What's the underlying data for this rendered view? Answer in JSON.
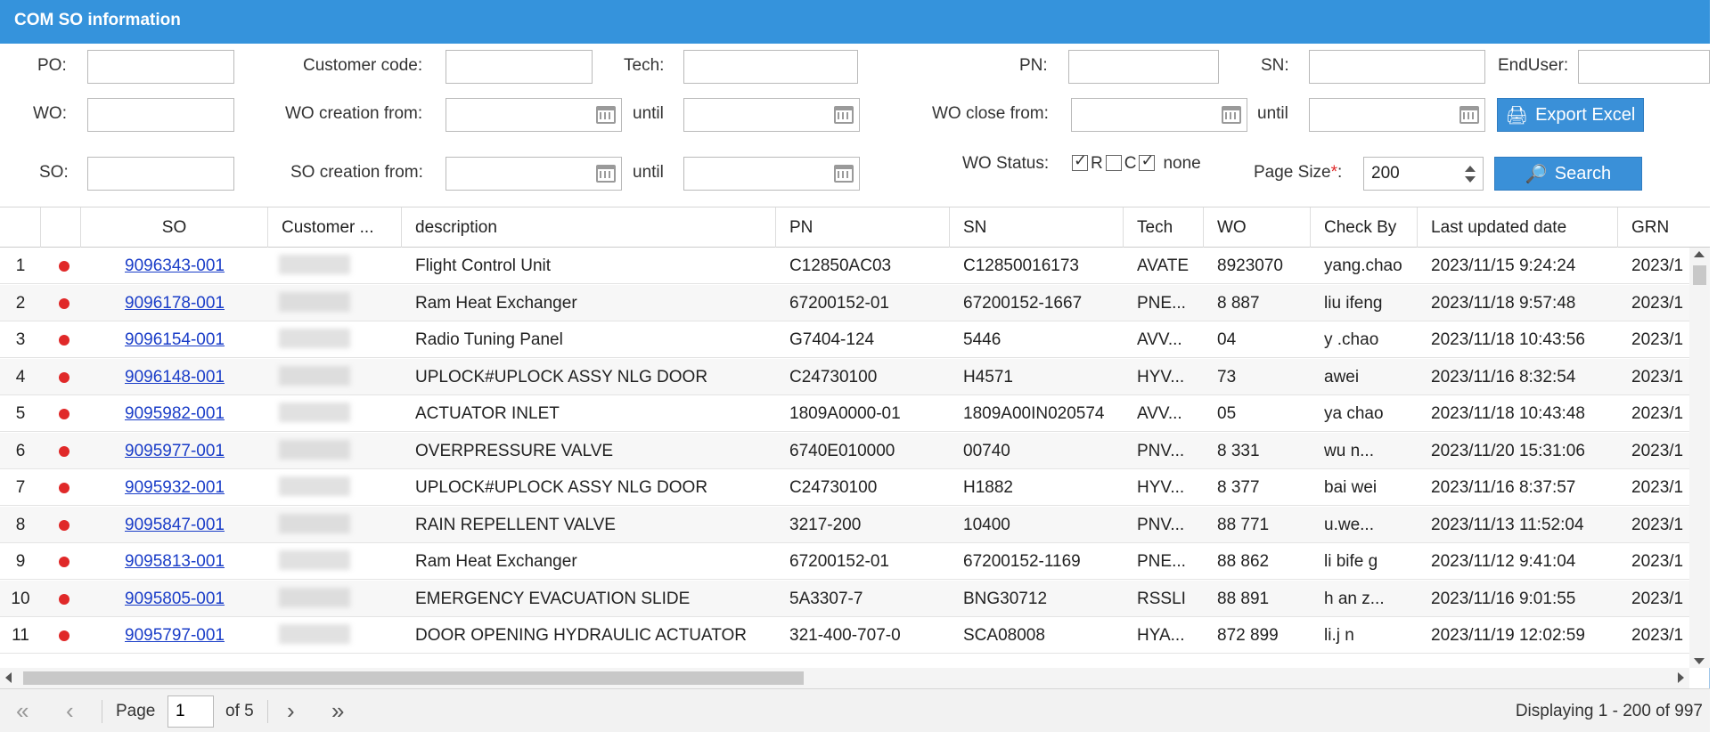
{
  "title": "COM SO information",
  "filters": {
    "po_label": "PO:",
    "customer_code_label": "Customer code:",
    "tech_label": "Tech:",
    "pn_label": "PN:",
    "sn_label": "SN:",
    "enduser_label": "EndUser:",
    "wo_label": "WO:",
    "wo_creation_from_label": "WO creation from:",
    "until_label": "until",
    "wo_close_from_label": "WO close from:",
    "so_label": "SO:",
    "so_creation_from_label": "SO creation from:",
    "wo_status_label": "WO Status:",
    "status_r": "R",
    "status_c": "C",
    "status_none": "none",
    "page_size_label": "Page Size",
    "required_mark": "*",
    "page_size_colon": ":",
    "page_size_value": "200",
    "export_label": "Export Excel",
    "search_label": "Search"
  },
  "columns": [
    "SO",
    "Customer ...",
    "description",
    "PN",
    "SN",
    "Tech",
    "WO",
    "Check By",
    "Last updated date",
    "GRN"
  ],
  "rows": [
    {
      "n": "1",
      "so": "9096343-001",
      "desc": "Flight Control Unit",
      "pn": "C12850AC03",
      "sn": "C12850016173",
      "tech": "AVATE",
      "wo": "8923070",
      "check": "yang.chao",
      "date": "2023/11/15 9:24:24",
      "grn": "2023/1"
    },
    {
      "n": "2",
      "so": "9096178-001",
      "desc": "Ram Heat Exchanger",
      "pn": "67200152-01",
      "sn": "67200152-1667",
      "tech": "PNE...",
      "wo": "8  887",
      "check": "liu  ifeng",
      "date": "2023/11/18 9:57:48",
      "grn": "2023/1"
    },
    {
      "n": "3",
      "so": "9096154-001",
      "desc": "Radio Tuning Panel",
      "pn": "G7404-124",
      "sn": "5446",
      "tech": "AVV...",
      "wo": "  04",
      "check": "y  .chao",
      "date": "2023/11/18 10:43:56",
      "grn": "2023/1"
    },
    {
      "n": "4",
      "so": "9096148-001",
      "desc": "UPLOCK#UPLOCK ASSY NLG DOOR",
      "pn": "C24730100",
      "sn": "H4571",
      "tech": "HYV...",
      "wo": "  73",
      "check": "  awei",
      "date": "2023/11/16 8:32:54",
      "grn": "2023/1"
    },
    {
      "n": "5",
      "so": "9095982-001",
      "desc": "ACTUATOR INLET",
      "pn": "1809A0000-01",
      "sn": "1809A00IN020574",
      "tech": "AVV...",
      "wo": "  05",
      "check": "ya  chao",
      "date": "2023/11/18 10:43:48",
      "grn": "2023/1"
    },
    {
      "n": "6",
      "so": "9095977-001",
      "desc": "OVERPRESSURE VALVE",
      "pn": "6740E010000",
      "sn": "00740",
      "tech": "PNV...",
      "wo": "8  331",
      "check": "wu  n...",
      "date": "2023/11/20 15:31:06",
      "grn": "2023/1"
    },
    {
      "n": "7",
      "so": "9095932-001",
      "desc": "UPLOCK#UPLOCK ASSY NLG DOOR",
      "pn": "C24730100",
      "sn": "H1882",
      "tech": "HYV...",
      "wo": "8  377",
      "check": "bai  wei",
      "date": "2023/11/16 8:37:57",
      "grn": "2023/1"
    },
    {
      "n": "8",
      "so": "9095847-001",
      "desc": "RAIN REPELLENT VALVE",
      "pn": "3217-200",
      "sn": "10400",
      "tech": "PNV...",
      "wo": "88  771",
      "check": "  u.we...",
      "date": "2023/11/13 11:52:04",
      "grn": "2023/1"
    },
    {
      "n": "9",
      "so": "9095813-001",
      "desc": "Ram Heat Exchanger",
      "pn": "67200152-01",
      "sn": "67200152-1169",
      "tech": "PNE...",
      "wo": "88  862",
      "check": "li  bife  g",
      "date": "2023/11/12 9:41:04",
      "grn": "2023/1"
    },
    {
      "n": "10",
      "so": "9095805-001",
      "desc": "EMERGENCY EVACUATION SLIDE",
      "pn": "5A3307-7",
      "sn": "BNG30712",
      "tech": "RSSLI",
      "wo": "88  891",
      "check": "h  an  z...",
      "date": "2023/11/16 9:01:55",
      "grn": "2023/1"
    },
    {
      "n": "11",
      "so": "9095797-001",
      "desc": "DOOR OPENING HYDRAULIC ACTUATOR",
      "pn": "321-400-707-0",
      "sn": "SCA08008",
      "tech": "HYA...",
      "wo": "872  899",
      "check": "li.j  n",
      "date": "2023/11/19 12:02:59",
      "grn": "2023/1"
    }
  ],
  "pager": {
    "page_label": "Page",
    "page_value": "1",
    "of_label": "of 5",
    "display_text": "Displaying 1 - 200 of 997"
  },
  "colors": {
    "header": "#3593dc",
    "button": "#3a90d8",
    "link": "#1a3dc8",
    "status_dot": "#e02929"
  }
}
